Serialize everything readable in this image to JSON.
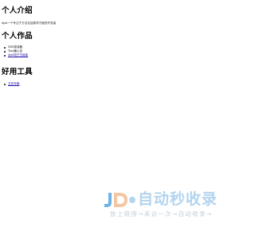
{
  "intro": {
    "heading": "个人介绍",
    "text": "dpxd一个专注于方法论及数学方面的开发者"
  },
  "works": {
    "heading": "个人作品",
    "items": [
      {
        "label": "GSG混沌器",
        "is_link": false
      },
      {
        "label": "Toxy输入法",
        "is_link": false
      },
      {
        "label": "dpxd电子书阅读",
        "is_link": true
      }
    ]
  },
  "tools": {
    "heading": "好用工具",
    "items": [
      {
        "label": "文件传输",
        "is_link": true
      }
    ]
  },
  "watermark": {
    "title": "自动秒收录",
    "slogan": "放上链接→来访一次→自动收录→",
    "colors": {
      "accent": "#6fb3e6",
      "accent_light": "#b3d4ee",
      "slogan": "#c2cfd8"
    }
  }
}
